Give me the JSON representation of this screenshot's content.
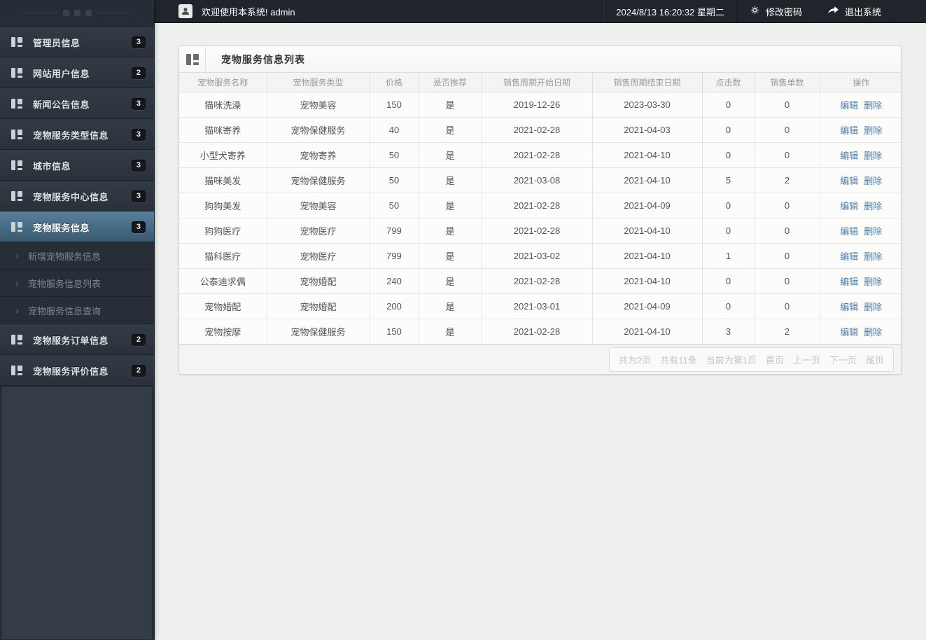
{
  "topbar": {
    "welcome": "欢迎使用本系统! admin",
    "datetime": "2024/8/13 16:20:32 星期二",
    "change_password_label": "修改密码",
    "logout_label": "退出系统"
  },
  "sidebar": {
    "items": [
      {
        "label": "管理员信息",
        "badge": "3"
      },
      {
        "label": "网站用户信息",
        "badge": "2"
      },
      {
        "label": "新闻公告信息",
        "badge": "3"
      },
      {
        "label": "宠物服务类型信息",
        "badge": "3"
      },
      {
        "label": "城市信息",
        "badge": "3"
      },
      {
        "label": "宠物服务中心信息",
        "badge": "3"
      },
      {
        "label": "宠物服务信息",
        "badge": "3",
        "active": true,
        "children": [
          "新增宠物服务信息",
          "宠物服务信息列表",
          "宠物服务信息查询"
        ]
      },
      {
        "label": "宠物服务订单信息",
        "badge": "2"
      },
      {
        "label": "宠物服务评价信息",
        "badge": "2"
      }
    ]
  },
  "panel": {
    "title": "宠物服务信息列表"
  },
  "table": {
    "columns": [
      "宠物服务名称",
      "宠物服务类型",
      "价格",
      "是否推荐",
      "销售周期开始日期",
      "销售周期结束日期",
      "点击数",
      "销售单数",
      "操作"
    ],
    "actions": {
      "edit": "编辑",
      "delete": "删除"
    },
    "rows": [
      [
        "猫咪洗澡",
        "宠物美容",
        "150",
        "是",
        "2019-12-26",
        "2023-03-30",
        "0",
        "0"
      ],
      [
        "猫咪寄养",
        "宠物保健服务",
        "40",
        "是",
        "2021-02-28",
        "2021-04-03",
        "0",
        "0"
      ],
      [
        "小型犬寄养",
        "宠物寄养",
        "50",
        "是",
        "2021-02-28",
        "2021-04-10",
        "0",
        "0"
      ],
      [
        "猫咪美发",
        "宠物保健服务",
        "50",
        "是",
        "2021-03-08",
        "2021-04-10",
        "5",
        "2"
      ],
      [
        "狗狗美发",
        "宠物美容",
        "50",
        "是",
        "2021-02-28",
        "2021-04-09",
        "0",
        "0"
      ],
      [
        "狗狗医疗",
        "宠物医疗",
        "799",
        "是",
        "2021-02-28",
        "2021-04-10",
        "0",
        "0"
      ],
      [
        "猫科医疗",
        "宠物医疗",
        "799",
        "是",
        "2021-03-02",
        "2021-04-10",
        "1",
        "0"
      ],
      [
        "公泰迪求偶",
        "宠物婚配",
        "240",
        "是",
        "2021-02-28",
        "2021-04-10",
        "0",
        "0"
      ],
      [
        "宠物婚配",
        "宠物婚配",
        "200",
        "是",
        "2021-03-01",
        "2021-04-09",
        "0",
        "0"
      ],
      [
        "宠物按摩",
        "宠物保健服务",
        "150",
        "是",
        "2021-02-28",
        "2021-04-10",
        "3",
        "2"
      ]
    ]
  },
  "pagination": {
    "stats": [
      "共为2页",
      "共有11条",
      "当前为第1页"
    ],
    "links": [
      "首页",
      "上一页",
      "下一页",
      "尾页"
    ]
  },
  "colors": {
    "accent_blue": "#4d7ea8",
    "active_item_top": "#577f9b",
    "active_item_bottom": "#3a5970",
    "header_bg": "#20252c",
    "sidebar_bg": "#262d36"
  }
}
